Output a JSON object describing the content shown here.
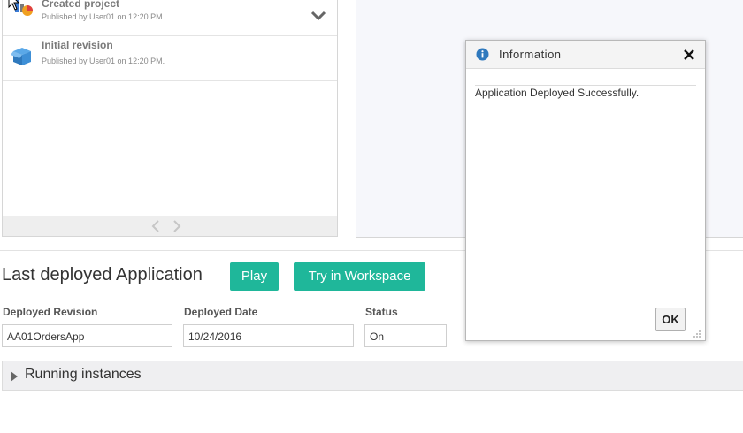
{
  "revisions": [
    {
      "title": "Created project",
      "meta": "Published by User01 on 12:20 PM."
    },
    {
      "title": "Initial revision",
      "meta": "Published by User01 on 12:20 PM."
    }
  ],
  "deployed": {
    "title": "Last deployed Application",
    "play_label": "Play",
    "try_label": "Try in Workspace",
    "fields": [
      {
        "label": "Deployed Revision",
        "value": "AA01OrdersApp"
      },
      {
        "label": "Deployed Date",
        "value": "10/24/2016"
      },
      {
        "label": "Status",
        "value": "On"
      }
    ],
    "running_label": "Running instances"
  },
  "dialog": {
    "title": "Information",
    "message": "Application Deployed Successfully.",
    "ok_label": "OK"
  },
  "colors": {
    "accent": "#1fb79a",
    "info": "#2f79bd"
  }
}
